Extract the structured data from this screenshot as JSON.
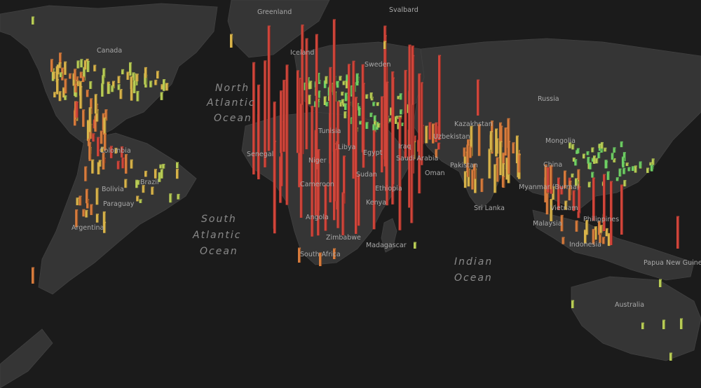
{
  "map": {
    "labels": {
      "greenland": "Greenland",
      "svalbard": "Svalbard",
      "canada": "Canada",
      "iceland": "Iceland",
      "sweden": "Sweden",
      "russia": "Russia",
      "kazakhstan": "Kazakhstan",
      "uzbekistan": "Uzbekistan",
      "mongolia": "Mongolia",
      "china": "China",
      "colombia": "Colombia",
      "brazil": "Brazil",
      "bolivia": "Bolivia",
      "paraguay": "Paraguay",
      "argentina": "Argentina",
      "senegal": "Senegal",
      "tunisia": "Tunisia",
      "libya": "Libya",
      "egypt": "Egypt",
      "niger": "Niger",
      "sudan": "Sudan",
      "ethiopia": "Ethiopia",
      "kenya": "Kenya",
      "cameroon": "Cameroon",
      "angola": "Angola",
      "zimbabwe": "Zimbabwe",
      "south_africa": "South Africa",
      "madagascar": "Madagascar",
      "iraq": "Iraq",
      "saudi_arabia": "Saudi Arabia",
      "oman": "Oman",
      "pakistan": "Pakistan",
      "myanmar": "Myanmar (Burma)",
      "sri_lanka": "Sri Lanka",
      "vietnam": "Vietnam",
      "malaysia": "Malaysia",
      "philippines": "Philippines",
      "indonesia": "Indonesia",
      "papua_new_guinea": "Papua New Guinea",
      "australia": "Australia"
    },
    "oceans": {
      "north_atlantic": [
        "North",
        "Atlantic",
        "Ocean"
      ],
      "south_atlantic": [
        "South",
        "Atlantic",
        "Ocean"
      ],
      "indian": [
        "Indian",
        "Ocean"
      ]
    },
    "colors": {
      "background": "#1b1b1b",
      "land": "#353535",
      "high": "#d0453a",
      "med_high": "#d77b3c",
      "medium": "#d9b44a",
      "low_medium": "#b8cc55",
      "low": "#6fd065"
    }
  }
}
